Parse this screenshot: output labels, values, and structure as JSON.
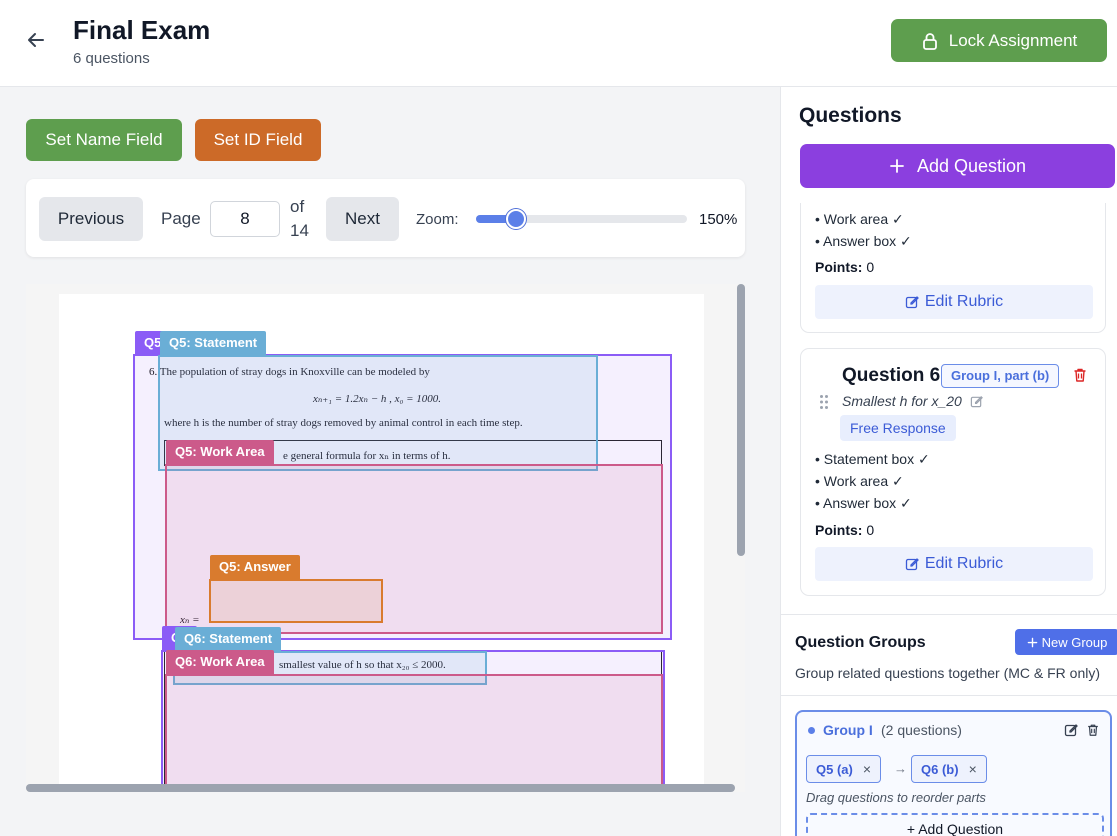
{
  "header": {
    "title": "Final Exam",
    "subtitle": "6 questions",
    "lock_label": "Lock Assignment"
  },
  "toolbar": {
    "name_field_label": "Set Name Field",
    "id_field_label": "Set ID Field"
  },
  "pager": {
    "prev_label": "Previous",
    "page_label": "Page",
    "current_page": "8",
    "of_label": "of",
    "total_pages": "14",
    "next_label": "Next",
    "zoom_label": "Zoom:",
    "zoom_value": "150%",
    "zoom_fraction": 0.19
  },
  "document": {
    "line1": "6. The population of stray dogs in Knoxville can be modeled by",
    "equation": "xₙ₊₁ = 1.2xₙ − h   ,   x₀ = 1000.",
    "line2": "where h is the number of stray dogs removed by animal control in each time step.",
    "part_a": "e general formula for xₙ in terms of h.",
    "answer_prefix": "xₙ =",
    "part_b": "smallest value of h so that x₂₀ ≤ 2000."
  },
  "regions": {
    "q5_group": "Q5",
    "q5_statement": "Q5: Statement",
    "q5_work": "Q5: Work Area",
    "q5_answer": "Q5: Answer",
    "q6_group": "Q6",
    "q6_statement": "Q6: Statement",
    "q6_work": "Q6: Work Area",
    "colors": {
      "group": "#8b5cf6",
      "statement": "#6aaed6",
      "work": "#cc5a8a",
      "answer": "#d97b2e"
    }
  },
  "sidebar": {
    "heading": "Questions",
    "add_label": "Add Question",
    "question5": {
      "bullets": [
        "• Work area ✓",
        "• Answer box ✓"
      ],
      "points_label": "Points:",
      "points_value": "0",
      "edit_label": "Edit Rubric"
    },
    "question6": {
      "title": "Question 6",
      "group_badge": "Group I, part (b)",
      "description": "Smallest h for x_20",
      "type": "Free Response",
      "bullets": [
        "• Statement box ✓",
        "• Work area ✓",
        "• Answer box ✓"
      ],
      "points_label": "Points:",
      "points_value": "0",
      "edit_label": "Edit Rubric"
    }
  },
  "groups": {
    "heading": "Question Groups",
    "new_label": "New Group",
    "description": "Group related questions together (MC & FR only)",
    "group": {
      "name": "Group I",
      "count": "(2 questions)",
      "chips": [
        "Q5 (a)",
        "Q6 (b)"
      ],
      "chip_remove": "×",
      "arrow": "→",
      "hint": "Drag questions to reorder parts",
      "add_label": "+ Add Question"
    }
  }
}
